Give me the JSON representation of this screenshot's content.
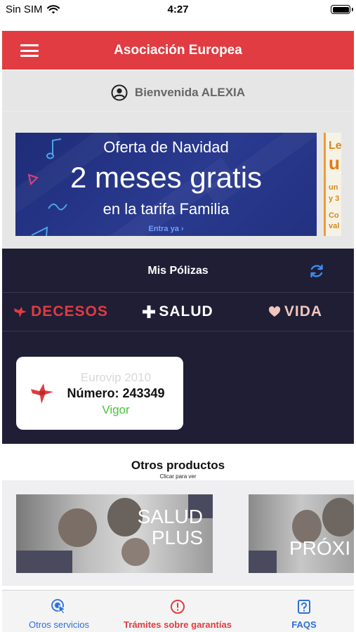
{
  "status_bar": {
    "carrier": "Sin SIM",
    "time": "4:27",
    "icons": [
      "wifi-icon",
      "battery-icon"
    ]
  },
  "navbar": {
    "title": "Asociación Europea",
    "menu_icon": "hamburger-menu-icon"
  },
  "welcome": {
    "text": "Bienvenida ALEXIA",
    "icon": "user-circle-icon"
  },
  "banner": {
    "line1": "Oferta de Navidad",
    "line2": "2 meses gratis",
    "line3": "en la tarifa Familia",
    "cta": "Entra ya ›"
  },
  "banner_next": {
    "partial_lines": [
      "Le",
      "u",
      "un",
      "y 3",
      "Co",
      "val"
    ]
  },
  "policies": {
    "title": "Mis Pólizas",
    "refresh_icon": "refresh-icon",
    "tabs": [
      {
        "label": "DECESOS",
        "icon": "dove-icon",
        "color": "#e03c41"
      },
      {
        "label": "SALUD",
        "icon": "plus-icon",
        "color": "#ffffff"
      },
      {
        "label": "VIDA",
        "icon": "heart-icon",
        "color": "#f0c6bd"
      }
    ],
    "card": {
      "name": "Eurovip 2010",
      "number": "Número: 243349",
      "status": "Vigor",
      "logo_icon": "dove-icon"
    }
  },
  "other_products": {
    "title": "Otros productos",
    "subtitle": "Clicar para ver",
    "items": [
      {
        "line1": "SALUD",
        "line2": "PLUS"
      },
      {
        "line1": "PRÓXI",
        "line2": ""
      }
    ]
  },
  "tabbar": {
    "items": [
      {
        "label": "Otros servicios",
        "icon": "touch-icon",
        "color": "#2f6fd8"
      },
      {
        "label": "Trámites sobre garantías",
        "icon": "alert-circle-icon",
        "color": "#e03c41"
      },
      {
        "label": "FAQS",
        "icon": "question-icon",
        "color": "#2f6fd8"
      }
    ]
  },
  "colors": {
    "brand_red": "#e03c41",
    "dark_navy": "#1f1e35",
    "status_green": "#48c23c",
    "link_blue": "#2f6fd8"
  }
}
